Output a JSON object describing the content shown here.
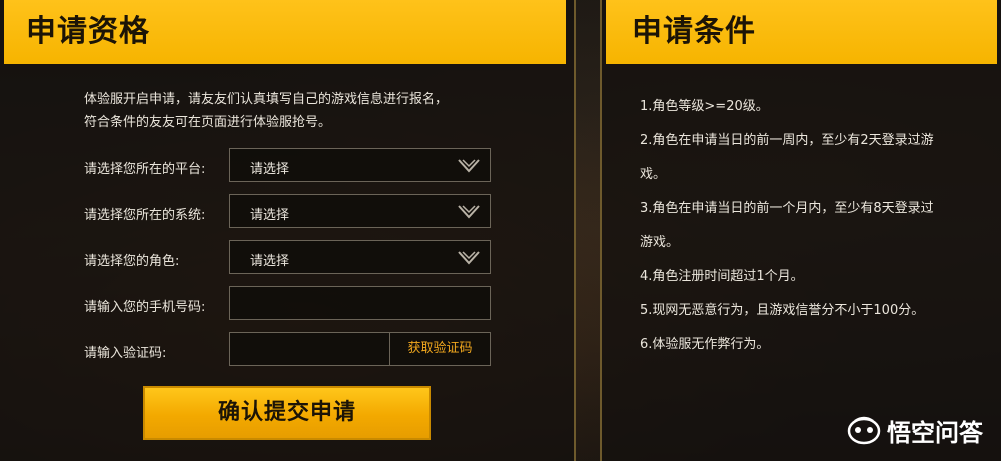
{
  "left_panel": {
    "title": "申请资格",
    "intro_lines": [
      "体验服开启申请，请友友们认真填写自己的游戏信息进行报名，",
      "符合条件的友友可在页面进行体验服抢号。"
    ],
    "form": {
      "platform": {
        "label": "请选择您所在的平台:",
        "value": "请选择"
      },
      "system": {
        "label": "请选择您所在的系统:",
        "value": "请选择"
      },
      "role": {
        "label": "请选择您的角色:",
        "value": "请选择"
      },
      "phone": {
        "label": "请输入您的手机号码:",
        "value": ""
      },
      "code": {
        "label": "请输入验证码:",
        "value": "",
        "button": "获取验证码"
      }
    },
    "submit_label": "确认提交申请"
  },
  "right_panel": {
    "title": "申请条件",
    "conditions": [
      "1.角色等级>=20级。",
      "2.角色在申请当日的前一周内，至少有2天登录过游",
      "戏。",
      "3.角色在申请当日的前一个月内，至少有8天登录过",
      "游戏。",
      "4.角色注册时间超过1个月。",
      "5.现网无恶意行为，且游戏信誉分不小于100分。",
      "6.体验服无作弊行为。"
    ]
  },
  "watermark": {
    "text": "悟空问答"
  },
  "colors": {
    "header_yellow": "#f6b400",
    "accent_orange": "#f2a81e",
    "panel_bg": "#14110e"
  }
}
